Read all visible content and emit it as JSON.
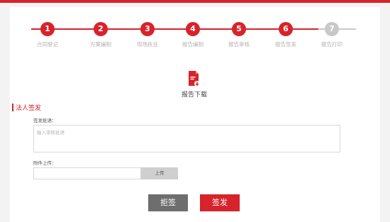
{
  "steps": [
    {
      "number": "1",
      "label": "合同登记",
      "state": "done"
    },
    {
      "number": "2",
      "label": "方案编制",
      "state": "done"
    },
    {
      "number": "3",
      "label": "现场执业",
      "state": "done"
    },
    {
      "number": "4",
      "label": "报告编制",
      "state": "done"
    },
    {
      "number": "5",
      "label": "报告审核",
      "state": "done"
    },
    {
      "number": "6",
      "label": "报告签发",
      "state": "done"
    },
    {
      "number": "7",
      "label": "报告打印",
      "state": "todo"
    }
  ],
  "download": {
    "label": "报告下载",
    "icon": "pdf-download-icon"
  },
  "section": {
    "title": "法人签发"
  },
  "opinion": {
    "label": "签发批语：",
    "placeholder": "输入审核批语",
    "value": ""
  },
  "attachment": {
    "label": "附件上传：",
    "upload_label": "上传"
  },
  "actions": {
    "reject_label": "拒签",
    "sign_label": "签发"
  },
  "colors": {
    "accent": "#d7232b",
    "inactive": "#c8c8c8",
    "reject": "#6e6e6e"
  }
}
